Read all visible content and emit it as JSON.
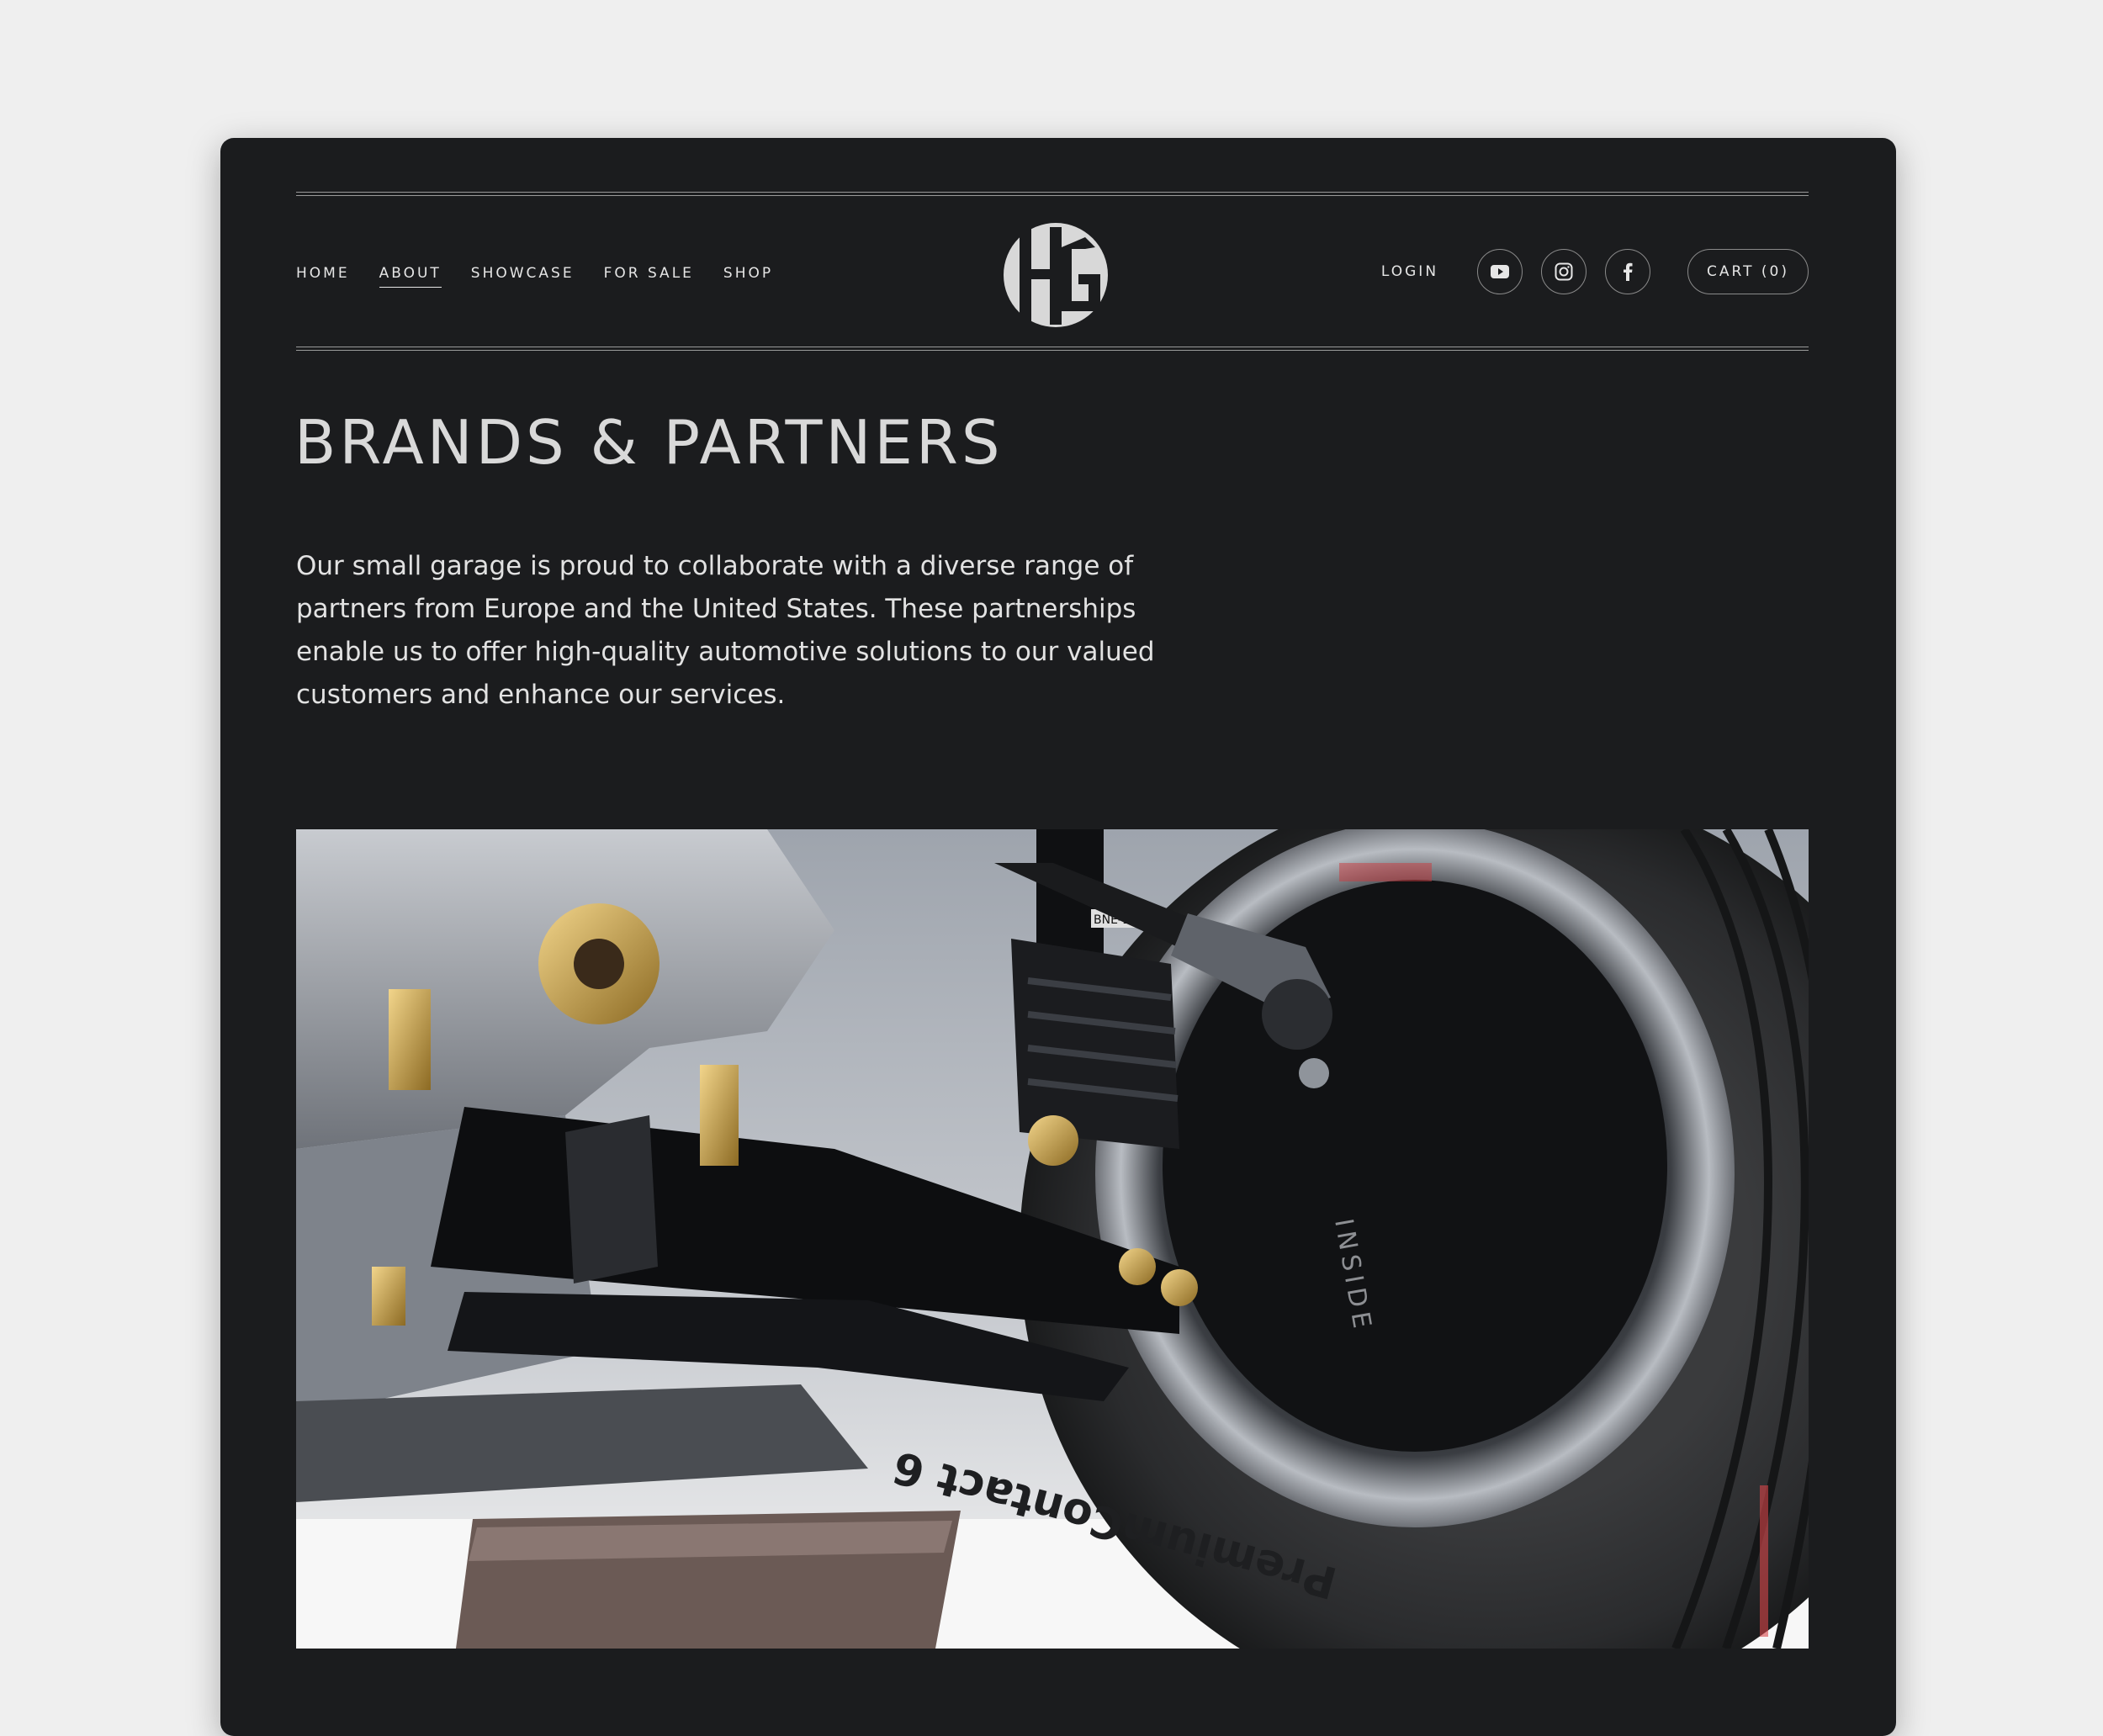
{
  "nav": {
    "items": [
      {
        "label": "HOME",
        "active": false
      },
      {
        "label": "ABOUT",
        "active": true
      },
      {
        "label": "SHOWCASE",
        "active": false
      },
      {
        "label": "FOR SALE",
        "active": false
      },
      {
        "label": "SHOP",
        "active": false
      }
    ]
  },
  "logo": {
    "text": "HG"
  },
  "header": {
    "login_label": "LOGIN",
    "social_icons": [
      "youtube-icon",
      "instagram-icon",
      "facebook-icon"
    ],
    "cart_label": "CART (0)"
  },
  "main": {
    "title": "BRANDS & PARTNERS",
    "description": "Our small garage is proud to collaborate with a diverse range of partners from Europe and the United States. These partnerships enable us to offer high-quality automotive solutions to our valued customers and enhance our services."
  },
  "photo": {
    "tire_brand_text": "PremiumContact 6",
    "tire_side_text": "INSIDE",
    "shock_label_text": "BNE-1901"
  },
  "colors": {
    "background": "#efefef",
    "window": "#1b1c1e",
    "text": "#e6e6e6"
  }
}
